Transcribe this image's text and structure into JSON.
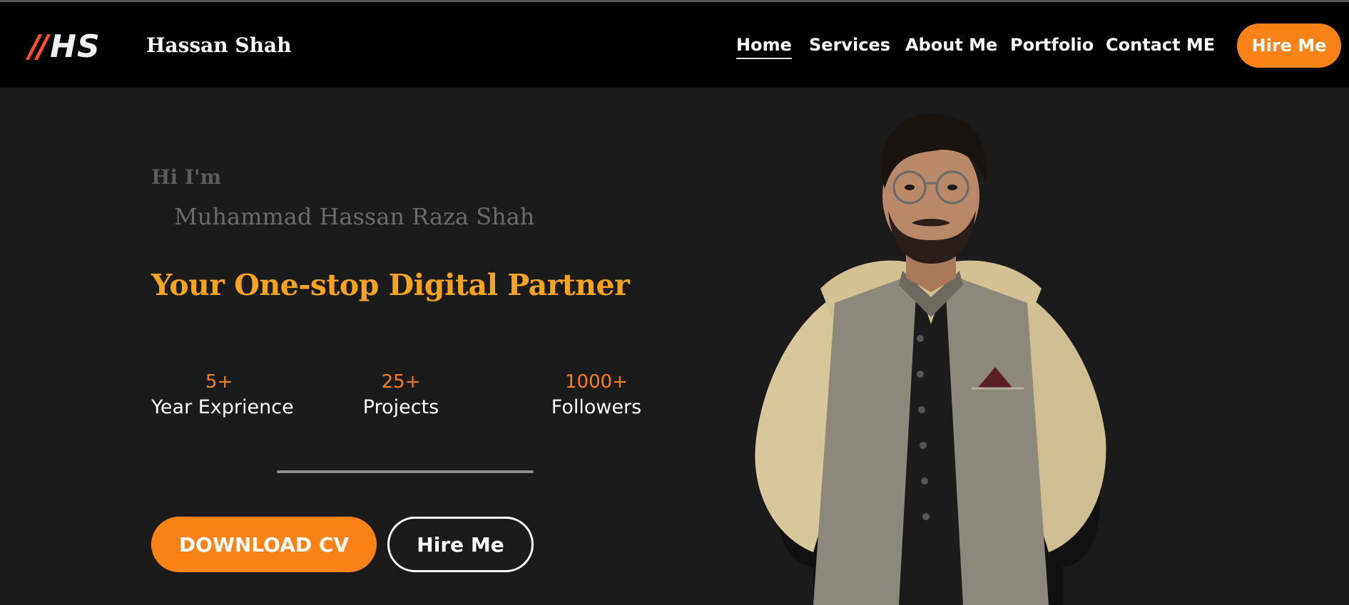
{
  "header": {
    "logo_text": "HS",
    "logo_slashes": "//",
    "brand_name": "Hassan Shah",
    "nav": [
      {
        "label": "Home",
        "active": true
      },
      {
        "label": "Services",
        "active": false
      },
      {
        "label": "About Me",
        "active": false
      },
      {
        "label": "Portfolio",
        "active": false
      },
      {
        "label": "Contact ME",
        "active": false
      }
    ],
    "cta_label": "Hire Me"
  },
  "hero": {
    "greeting": "Hi I'm",
    "name": "Muhammad Hassan Raza Shah",
    "tagline": "Your One-stop Digital Partner",
    "stats": [
      {
        "value": "5+",
        "label": "Year Exprience"
      },
      {
        "value": "25+",
        "label": "Projects"
      },
      {
        "value": "1000+",
        "label": "Followers"
      }
    ],
    "download_label": "DOWNLOAD CV",
    "hire_label": "Hire Me"
  },
  "colors": {
    "accent": "#fb8216",
    "tagline": "#f6a31f",
    "header_bg": "#000000",
    "page_bg": "#1b1b1b",
    "logo_red": "#ff4f33"
  }
}
